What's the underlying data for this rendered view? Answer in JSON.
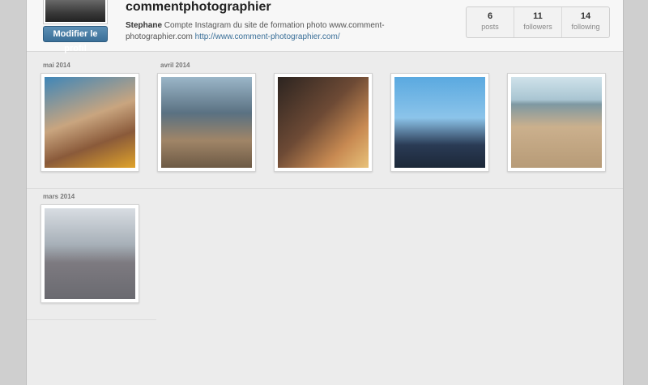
{
  "profile": {
    "username": "commentphotographier",
    "edit_label": "Modifier le profil",
    "bio_name": "Stephane",
    "bio_text": "Compte Instagram du site de formation photo www.comment-photographier.com",
    "bio_link": "http://www.comment-photographier.com/"
  },
  "stats": [
    {
      "value": "6",
      "label": "posts"
    },
    {
      "value": "11",
      "label": "followers"
    },
    {
      "value": "14",
      "label": "following"
    }
  ],
  "months": [
    "mai 2014",
    "avril 2014",
    "mars 2014"
  ],
  "colors": {
    "button": "#3a6f98",
    "link": "#3a6f98"
  }
}
